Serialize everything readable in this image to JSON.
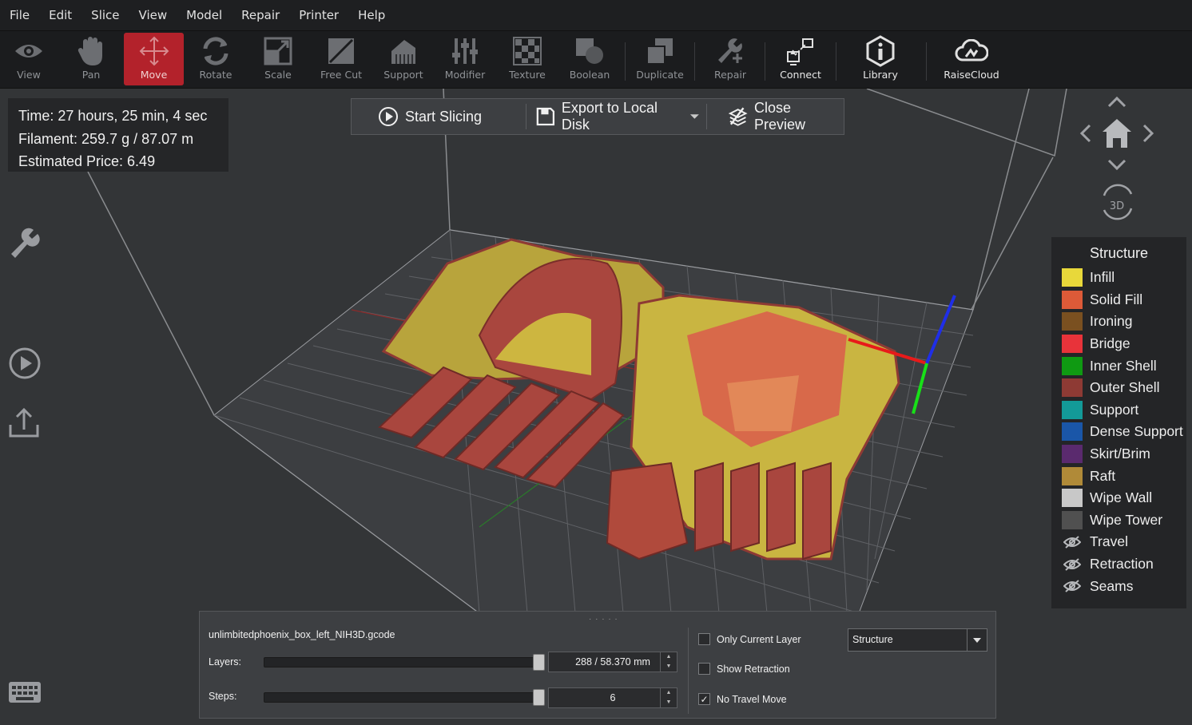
{
  "menu": [
    "File",
    "Edit",
    "Slice",
    "View",
    "Model",
    "Repair",
    "Printer",
    "Help"
  ],
  "toolbar": {
    "view": "View",
    "pan": "Pan",
    "move": "Move",
    "rotate": "Rotate",
    "scale": "Scale",
    "free_cut": "Free Cut",
    "support": "Support",
    "modifier": "Modifier",
    "texture": "Texture",
    "boolean": "Boolean",
    "duplicate": "Duplicate",
    "repair": "Repair",
    "connect": "Connect",
    "library": "Library",
    "raisecloud": "RaiseCloud"
  },
  "stats": {
    "time": "Time: 27 hours, 25 min, 4 sec",
    "filament": "Filament: 259.7 g / 87.07 m",
    "price": "Estimated Price: 6.49"
  },
  "actions": {
    "start_slicing": "Start Slicing",
    "export": "Export to Local Disk",
    "close_preview": "Close Preview"
  },
  "nav": {
    "mode_3d": "3D"
  },
  "legend": {
    "title": "Structure",
    "items": [
      {
        "label": "Infill",
        "color": "#e8d83a"
      },
      {
        "label": "Solid Fill",
        "color": "#dd5a38"
      },
      {
        "label": "Ironing",
        "color": "#7a5020"
      },
      {
        "label": "Bridge",
        "color": "#e8333a"
      },
      {
        "label": "Inner Shell",
        "color": "#0f9a12"
      },
      {
        "label": "Outer Shell",
        "color": "#8e3a34"
      },
      {
        "label": "Support",
        "color": "#139a98"
      },
      {
        "label": "Dense Support",
        "color": "#1a56a8"
      },
      {
        "label": "Skirt/Brim",
        "color": "#5a2a6e"
      },
      {
        "label": "Raft",
        "color": "#b08a38"
      },
      {
        "label": "Wipe Wall",
        "color": "#c8c8c8"
      },
      {
        "label": "Wipe Tower",
        "color": "#505050"
      }
    ],
    "hidden": [
      "Travel",
      "Retraction",
      "Seams"
    ]
  },
  "panel": {
    "filename": "unlimbitedphoenix_box_left_NIH3D.gcode",
    "layers_label": "Layers:",
    "layers_value": "288 / 58.370 mm",
    "steps_label": "Steps:",
    "steps_value": "6",
    "only_current_layer": "Only Current Layer",
    "show_retraction": "Show Retraction",
    "no_travel_move": "No Travel Move",
    "no_travel_checked": true,
    "display_mode": "Structure"
  }
}
